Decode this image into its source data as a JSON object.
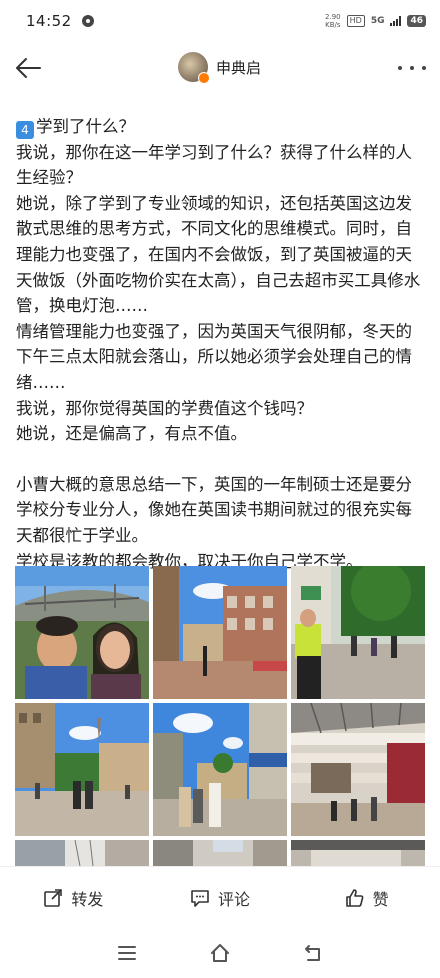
{
  "status_bar": {
    "time": "14:52",
    "speed_value": "2.90",
    "speed_unit": "KB/s",
    "hd": "HD",
    "network": "5G",
    "battery": "46"
  },
  "header": {
    "author_name": "申典启"
  },
  "post": {
    "section_number": "4",
    "lines": [
      "学到了什么？",
      "我说，那你在这一年学习到了什么？获得了什么样的人生经验？",
      "她说，除了学到了专业领域的知识，还包括英国这边发散式思维的思考方式，不同文化的思维模式。同时，自理能力也变强了，在国内不会做饭，到了英国被逼的天天做饭（外面吃物价实在太高），自己去超市买工具修水管，换电灯泡……",
      "情绪管理能力也变强了，因为英国天气很阴郁，冬天的下午三点太阳就会落山，所以她必须学会处理自己的情绪……",
      "我说，那你觉得英国的学费值这个钱吗？",
      "她说，还是偏高了，有点不值。"
    ],
    "summary": [
      "小曹大概的意思总结一下，英国的一年制硕士还是要分学校分专业分人，像她在英国读书期间就过的很充实每天都很忙于学业。",
      "学校是该教的都会教你，取决于你自己学不学。"
    ]
  },
  "photos": [
    {
      "name": "photo-bridge-selfie"
    },
    {
      "name": "photo-street-buildings"
    },
    {
      "name": "photo-pedestrian-street"
    },
    {
      "name": "photo-town-square"
    },
    {
      "name": "photo-shopping-street"
    },
    {
      "name": "photo-shopping-mall"
    },
    {
      "name": "photo-partial-1"
    },
    {
      "name": "photo-partial-2"
    },
    {
      "name": "photo-partial-3"
    }
  ],
  "actions": {
    "repost": "转发",
    "comment": "评论",
    "like": "赞"
  },
  "colors": {
    "accent": "#ff7a00",
    "keycap": "#3b8de0",
    "text": "#222222"
  }
}
